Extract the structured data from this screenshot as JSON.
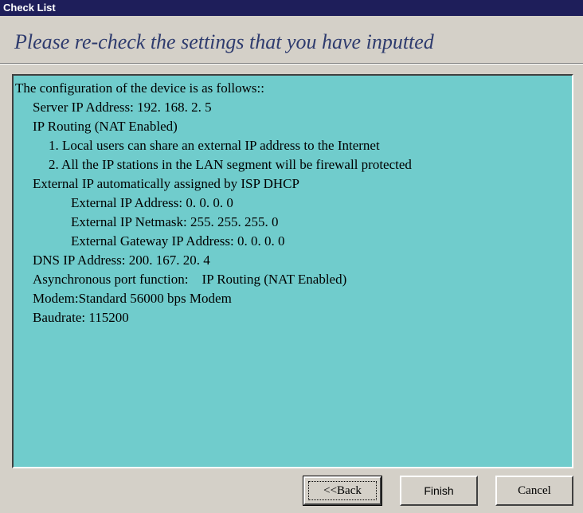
{
  "window": {
    "title": "Check List"
  },
  "heading": "Please re-check the settings that you have inputted",
  "summary": {
    "lines": [
      {
        "level": 0,
        "text": "The configuration of the device is as follows::"
      },
      {
        "level": 1,
        "text": "Server IP Address: 192. 168. 2. 5"
      },
      {
        "level": 1,
        "text": "IP Routing (NAT Enabled)"
      },
      {
        "level": 2,
        "text": "1. Local users can share an external IP address to the Internet"
      },
      {
        "level": 2,
        "text": "2. All the IP stations in the LAN segment will be firewall protected"
      },
      {
        "level": 1,
        "text": "External IP automatically assigned by ISP DHCP"
      },
      {
        "level": 3,
        "text": "External IP Address: 0. 0. 0. 0"
      },
      {
        "level": 3,
        "text": "External IP Netmask: 255. 255. 255. 0"
      },
      {
        "level": 3,
        "text": "External Gateway IP Address: 0. 0. 0. 0"
      },
      {
        "level": 1,
        "text": "DNS IP Address: 200. 167. 20. 4"
      },
      {
        "level": 1,
        "text": "Asynchronous port function:    IP Routing (NAT Enabled)"
      },
      {
        "level": 1,
        "text": "Modem:Standard 56000 bps Modem"
      },
      {
        "level": 1,
        "text": "Baudrate: 115200"
      }
    ]
  },
  "buttons": {
    "back": "<<Back",
    "finish": "Finish",
    "cancel": "Cancel"
  },
  "colors": {
    "titlebar": "#1e1e5a",
    "summary_background": "#70cccc",
    "heading_text": "#2e3b6e",
    "dialog_face": "#d4d0c8"
  }
}
